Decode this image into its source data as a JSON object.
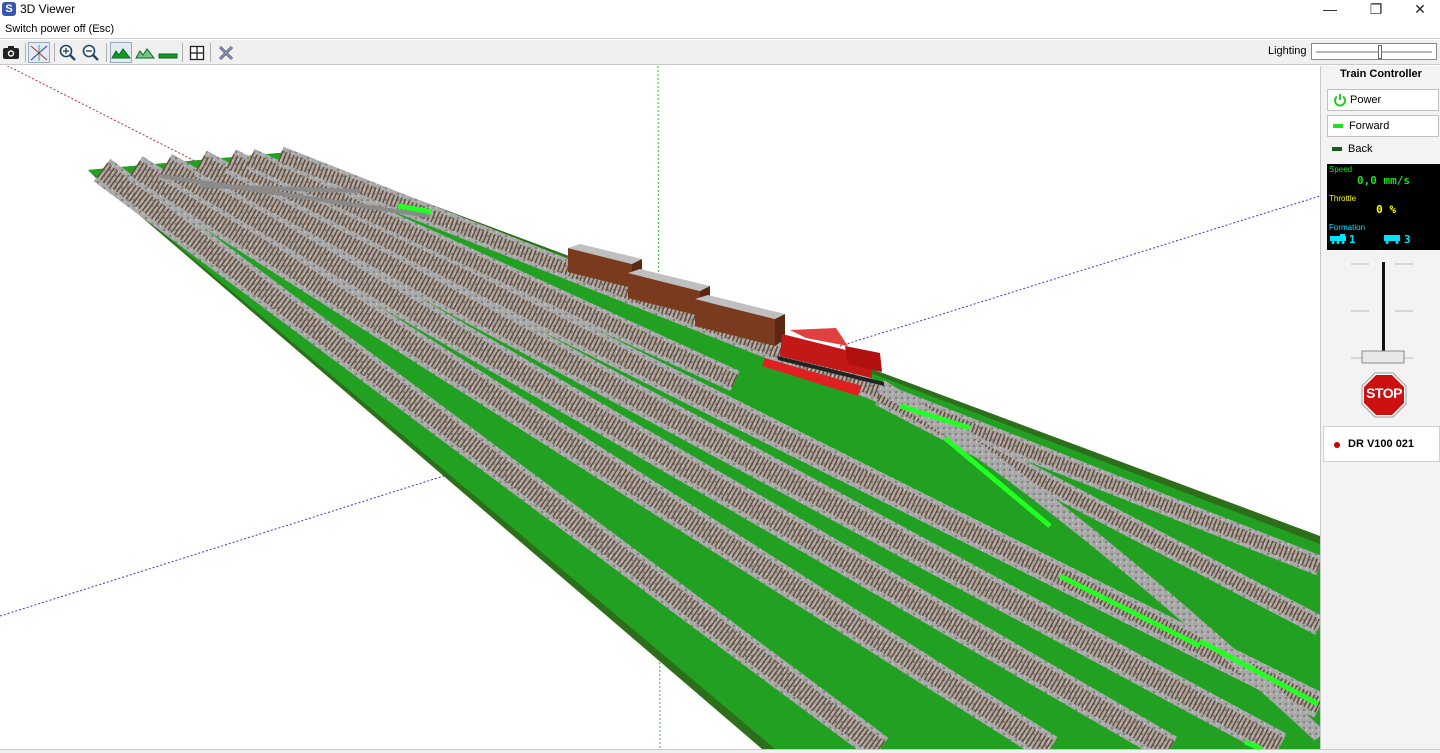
{
  "window": {
    "title": "3D Viewer",
    "app_icon": "S"
  },
  "status": {
    "hint": "Switch power off (Esc)"
  },
  "toolbar": {
    "buttons": [
      {
        "name": "camera-icon"
      },
      {
        "name": "axes-icon"
      },
      {
        "name": "zoom-in-icon"
      },
      {
        "name": "zoom-out-icon"
      },
      {
        "name": "terrain-icon"
      },
      {
        "name": "terrain-outline-icon"
      },
      {
        "name": "flat-icon"
      },
      {
        "name": "grid-icon"
      },
      {
        "name": "close-tool-icon"
      }
    ],
    "lighting_label": "Lighting",
    "lighting_level": 0.55
  },
  "controller": {
    "title": "Train Controller",
    "power_label": "Power",
    "forward_label": "Forward",
    "back_label": "Back",
    "speed_label": "Speed",
    "speed_value": "0,0 mm/s",
    "throttle_label": "Throttle",
    "throttle_value": "0 %",
    "formation_label": "Formation",
    "formation_locos": "1",
    "formation_cars": "3",
    "stop_label": "STOP",
    "loco_name": "DR V100 021",
    "colors": {
      "green": "#22dd22",
      "yellow": "#ffff00",
      "cyan": "#00e5ff",
      "red": "#cc0000"
    }
  }
}
